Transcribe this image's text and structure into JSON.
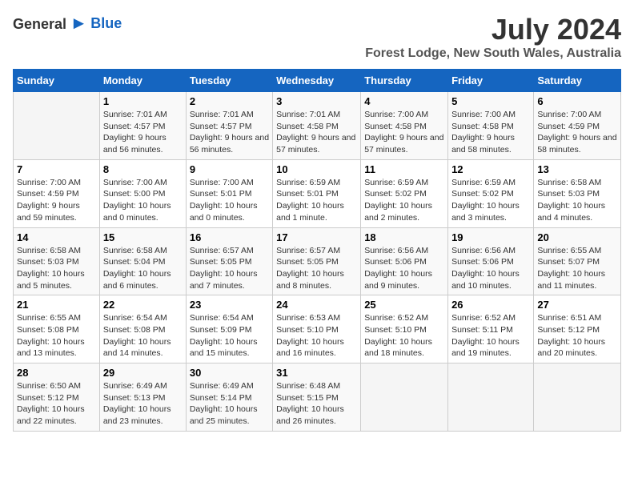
{
  "logo": {
    "text_general": "General",
    "text_blue": "Blue",
    "bird_symbol": "▲"
  },
  "title": {
    "month_year": "July 2024",
    "location": "Forest Lodge, New South Wales, Australia"
  },
  "days_of_week": [
    "Sunday",
    "Monday",
    "Tuesday",
    "Wednesday",
    "Thursday",
    "Friday",
    "Saturday"
  ],
  "weeks": [
    [
      {
        "day": "",
        "sunrise": "",
        "sunset": "",
        "daylight": ""
      },
      {
        "day": "1",
        "sunrise": "Sunrise: 7:01 AM",
        "sunset": "Sunset: 4:57 PM",
        "daylight": "Daylight: 9 hours and 56 minutes."
      },
      {
        "day": "2",
        "sunrise": "Sunrise: 7:01 AM",
        "sunset": "Sunset: 4:57 PM",
        "daylight": "Daylight: 9 hours and 56 minutes."
      },
      {
        "day": "3",
        "sunrise": "Sunrise: 7:01 AM",
        "sunset": "Sunset: 4:58 PM",
        "daylight": "Daylight: 9 hours and 57 minutes."
      },
      {
        "day": "4",
        "sunrise": "Sunrise: 7:00 AM",
        "sunset": "Sunset: 4:58 PM",
        "daylight": "Daylight: 9 hours and 57 minutes."
      },
      {
        "day": "5",
        "sunrise": "Sunrise: 7:00 AM",
        "sunset": "Sunset: 4:58 PM",
        "daylight": "Daylight: 9 hours and 58 minutes."
      },
      {
        "day": "6",
        "sunrise": "Sunrise: 7:00 AM",
        "sunset": "Sunset: 4:59 PM",
        "daylight": "Daylight: 9 hours and 58 minutes."
      }
    ],
    [
      {
        "day": "7",
        "sunrise": "Sunrise: 7:00 AM",
        "sunset": "Sunset: 4:59 PM",
        "daylight": "Daylight: 9 hours and 59 minutes."
      },
      {
        "day": "8",
        "sunrise": "Sunrise: 7:00 AM",
        "sunset": "Sunset: 5:00 PM",
        "daylight": "Daylight: 10 hours and 0 minutes."
      },
      {
        "day": "9",
        "sunrise": "Sunrise: 7:00 AM",
        "sunset": "Sunset: 5:01 PM",
        "daylight": "Daylight: 10 hours and 0 minutes."
      },
      {
        "day": "10",
        "sunrise": "Sunrise: 6:59 AM",
        "sunset": "Sunset: 5:01 PM",
        "daylight": "Daylight: 10 hours and 1 minute."
      },
      {
        "day": "11",
        "sunrise": "Sunrise: 6:59 AM",
        "sunset": "Sunset: 5:02 PM",
        "daylight": "Daylight: 10 hours and 2 minutes."
      },
      {
        "day": "12",
        "sunrise": "Sunrise: 6:59 AM",
        "sunset": "Sunset: 5:02 PM",
        "daylight": "Daylight: 10 hours and 3 minutes."
      },
      {
        "day": "13",
        "sunrise": "Sunrise: 6:58 AM",
        "sunset": "Sunset: 5:03 PM",
        "daylight": "Daylight: 10 hours and 4 minutes."
      }
    ],
    [
      {
        "day": "14",
        "sunrise": "Sunrise: 6:58 AM",
        "sunset": "Sunset: 5:03 PM",
        "daylight": "Daylight: 10 hours and 5 minutes."
      },
      {
        "day": "15",
        "sunrise": "Sunrise: 6:58 AM",
        "sunset": "Sunset: 5:04 PM",
        "daylight": "Daylight: 10 hours and 6 minutes."
      },
      {
        "day": "16",
        "sunrise": "Sunrise: 6:57 AM",
        "sunset": "Sunset: 5:05 PM",
        "daylight": "Daylight: 10 hours and 7 minutes."
      },
      {
        "day": "17",
        "sunrise": "Sunrise: 6:57 AM",
        "sunset": "Sunset: 5:05 PM",
        "daylight": "Daylight: 10 hours and 8 minutes."
      },
      {
        "day": "18",
        "sunrise": "Sunrise: 6:56 AM",
        "sunset": "Sunset: 5:06 PM",
        "daylight": "Daylight: 10 hours and 9 minutes."
      },
      {
        "day": "19",
        "sunrise": "Sunrise: 6:56 AM",
        "sunset": "Sunset: 5:06 PM",
        "daylight": "Daylight: 10 hours and 10 minutes."
      },
      {
        "day": "20",
        "sunrise": "Sunrise: 6:55 AM",
        "sunset": "Sunset: 5:07 PM",
        "daylight": "Daylight: 10 hours and 11 minutes."
      }
    ],
    [
      {
        "day": "21",
        "sunrise": "Sunrise: 6:55 AM",
        "sunset": "Sunset: 5:08 PM",
        "daylight": "Daylight: 10 hours and 13 minutes."
      },
      {
        "day": "22",
        "sunrise": "Sunrise: 6:54 AM",
        "sunset": "Sunset: 5:08 PM",
        "daylight": "Daylight: 10 hours and 14 minutes."
      },
      {
        "day": "23",
        "sunrise": "Sunrise: 6:54 AM",
        "sunset": "Sunset: 5:09 PM",
        "daylight": "Daylight: 10 hours and 15 minutes."
      },
      {
        "day": "24",
        "sunrise": "Sunrise: 6:53 AM",
        "sunset": "Sunset: 5:10 PM",
        "daylight": "Daylight: 10 hours and 16 minutes."
      },
      {
        "day": "25",
        "sunrise": "Sunrise: 6:52 AM",
        "sunset": "Sunset: 5:10 PM",
        "daylight": "Daylight: 10 hours and 18 minutes."
      },
      {
        "day": "26",
        "sunrise": "Sunrise: 6:52 AM",
        "sunset": "Sunset: 5:11 PM",
        "daylight": "Daylight: 10 hours and 19 minutes."
      },
      {
        "day": "27",
        "sunrise": "Sunrise: 6:51 AM",
        "sunset": "Sunset: 5:12 PM",
        "daylight": "Daylight: 10 hours and 20 minutes."
      }
    ],
    [
      {
        "day": "28",
        "sunrise": "Sunrise: 6:50 AM",
        "sunset": "Sunset: 5:12 PM",
        "daylight": "Daylight: 10 hours and 22 minutes."
      },
      {
        "day": "29",
        "sunrise": "Sunrise: 6:49 AM",
        "sunset": "Sunset: 5:13 PM",
        "daylight": "Daylight: 10 hours and 23 minutes."
      },
      {
        "day": "30",
        "sunrise": "Sunrise: 6:49 AM",
        "sunset": "Sunset: 5:14 PM",
        "daylight": "Daylight: 10 hours and 25 minutes."
      },
      {
        "day": "31",
        "sunrise": "Sunrise: 6:48 AM",
        "sunset": "Sunset: 5:15 PM",
        "daylight": "Daylight: 10 hours and 26 minutes."
      },
      {
        "day": "",
        "sunrise": "",
        "sunset": "",
        "daylight": ""
      },
      {
        "day": "",
        "sunrise": "",
        "sunset": "",
        "daylight": ""
      },
      {
        "day": "",
        "sunrise": "",
        "sunset": "",
        "daylight": ""
      }
    ]
  ]
}
